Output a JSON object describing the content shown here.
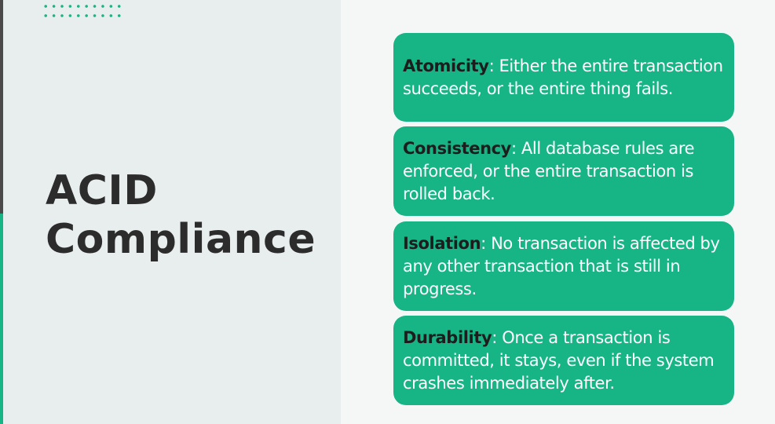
{
  "slide": {
    "title_line1": "ACID",
    "title_line2": "Compliance"
  },
  "cards": [
    {
      "term": "Atomicity",
      "text": ": Either the entire transaction succeeds, or the entire thing fails."
    },
    {
      "term": "Consistency",
      "text": ": All database rules are enforced, or the entire transaction is rolled back."
    },
    {
      "term": "Isolation",
      "text": ": No transaction is affected by any other transaction that is still in progress."
    },
    {
      "term": "Durability",
      "text": ": Once a transaction is committed, it stays, even if the system crashes immediately after."
    }
  ],
  "colors": {
    "accent": "#17b485",
    "title": "#2c2c2c",
    "left_panel": "#e8eded",
    "background": "#f5f6f6"
  }
}
